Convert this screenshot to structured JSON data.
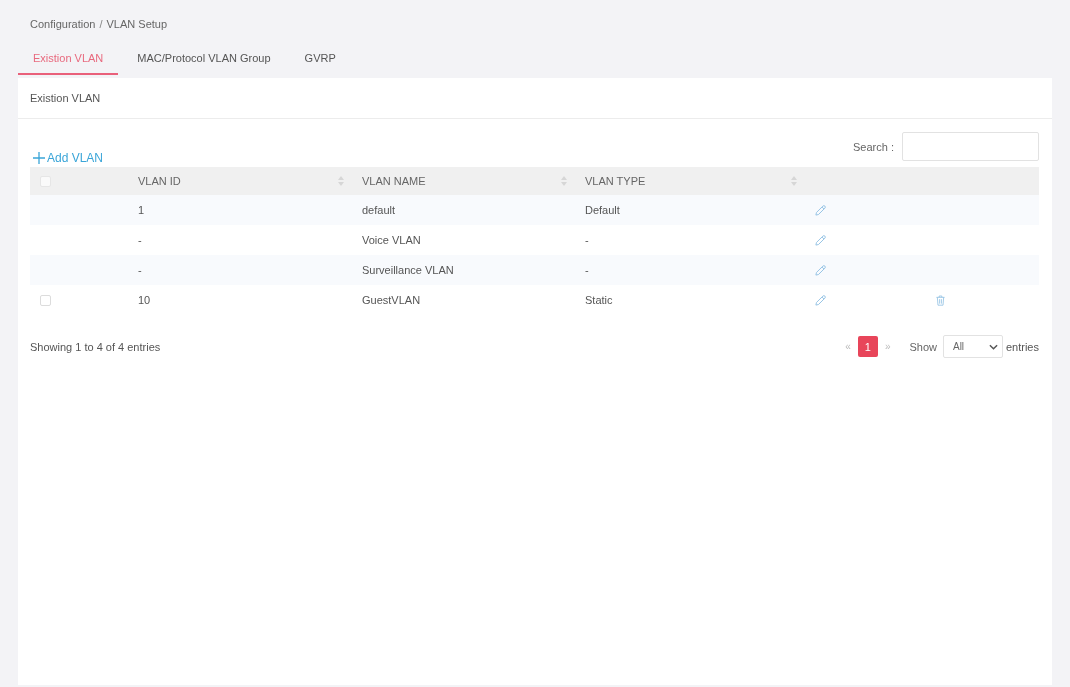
{
  "breadcrumb": {
    "items": [
      "Configuration",
      "VLAN Setup"
    ],
    "separator": "/"
  },
  "tabs": [
    {
      "label": "Existion VLAN",
      "selected": true
    },
    {
      "label": "MAC/Protocol VLAN Group",
      "selected": false
    },
    {
      "label": "GVRP",
      "selected": false
    }
  ],
  "panel": {
    "title": "Existion VLAN"
  },
  "add_button": {
    "label": "Add VLAN"
  },
  "search": {
    "label": "Search :"
  },
  "table": {
    "select_all": {
      "checked": false
    },
    "columns": [
      {
        "label": "VLAN ID",
        "sortable": true
      },
      {
        "label": "VLAN NAME",
        "sortable": true
      },
      {
        "label": "VLAN TYPE",
        "sortable": true
      }
    ],
    "rows": [
      {
        "kind": "system",
        "vlan_id": "1",
        "vlan_name": "default",
        "vlan_type": "Default"
      },
      {
        "kind": "system",
        "vlan_id": "-",
        "vlan_name": "Voice VLAN",
        "vlan_type": "-"
      },
      {
        "kind": "system",
        "vlan_id": "-",
        "vlan_name": "Surveillance VLAN",
        "vlan_type": "-"
      },
      {
        "kind": "user",
        "checked": false,
        "vlan_id": "10",
        "vlan_name": "GuestVLAN",
        "vlan_type": "Static"
      }
    ]
  },
  "footer": {
    "info": "Showing 1 to 4 of 4 entries",
    "prev": "«",
    "next": "»",
    "pages": [
      {
        "label": "1",
        "selected": true
      }
    ],
    "show_label": "Show",
    "page_size": "All",
    "entries_label": "entries"
  }
}
